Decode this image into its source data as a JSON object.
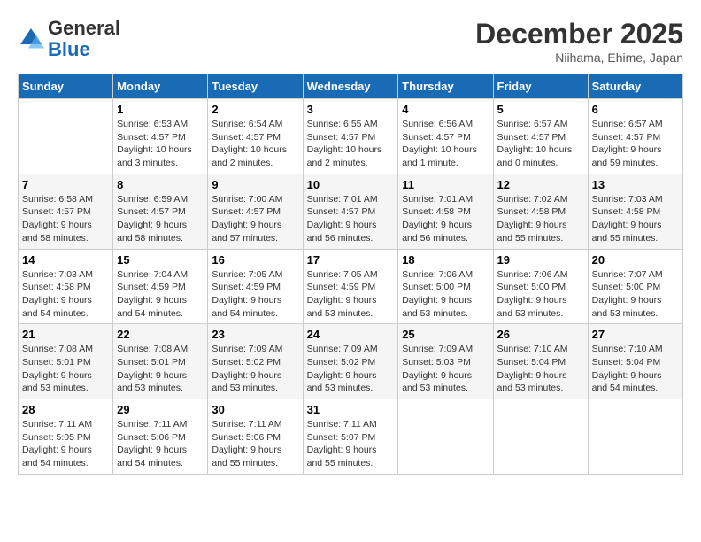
{
  "header": {
    "logo_line1": "General",
    "logo_line2": "Blue",
    "month": "December 2025",
    "location": "Niihama, Ehime, Japan"
  },
  "weekdays": [
    "Sunday",
    "Monday",
    "Tuesday",
    "Wednesday",
    "Thursday",
    "Friday",
    "Saturday"
  ],
  "weeks": [
    [
      {
        "day": "",
        "sunrise": "",
        "sunset": "",
        "daylight": ""
      },
      {
        "day": "1",
        "sunrise": "Sunrise: 6:53 AM",
        "sunset": "Sunset: 4:57 PM",
        "daylight": "Daylight: 10 hours and 3 minutes."
      },
      {
        "day": "2",
        "sunrise": "Sunrise: 6:54 AM",
        "sunset": "Sunset: 4:57 PM",
        "daylight": "Daylight: 10 hours and 2 minutes."
      },
      {
        "day": "3",
        "sunrise": "Sunrise: 6:55 AM",
        "sunset": "Sunset: 4:57 PM",
        "daylight": "Daylight: 10 hours and 2 minutes."
      },
      {
        "day": "4",
        "sunrise": "Sunrise: 6:56 AM",
        "sunset": "Sunset: 4:57 PM",
        "daylight": "Daylight: 10 hours and 1 minute."
      },
      {
        "day": "5",
        "sunrise": "Sunrise: 6:57 AM",
        "sunset": "Sunset: 4:57 PM",
        "daylight": "Daylight: 10 hours and 0 minutes."
      },
      {
        "day": "6",
        "sunrise": "Sunrise: 6:57 AM",
        "sunset": "Sunset: 4:57 PM",
        "daylight": "Daylight: 9 hours and 59 minutes."
      }
    ],
    [
      {
        "day": "7",
        "sunrise": "Sunrise: 6:58 AM",
        "sunset": "Sunset: 4:57 PM",
        "daylight": "Daylight: 9 hours and 58 minutes."
      },
      {
        "day": "8",
        "sunrise": "Sunrise: 6:59 AM",
        "sunset": "Sunset: 4:57 PM",
        "daylight": "Daylight: 9 hours and 58 minutes."
      },
      {
        "day": "9",
        "sunrise": "Sunrise: 7:00 AM",
        "sunset": "Sunset: 4:57 PM",
        "daylight": "Daylight: 9 hours and 57 minutes."
      },
      {
        "day": "10",
        "sunrise": "Sunrise: 7:01 AM",
        "sunset": "Sunset: 4:57 PM",
        "daylight": "Daylight: 9 hours and 56 minutes."
      },
      {
        "day": "11",
        "sunrise": "Sunrise: 7:01 AM",
        "sunset": "Sunset: 4:58 PM",
        "daylight": "Daylight: 9 hours and 56 minutes."
      },
      {
        "day": "12",
        "sunrise": "Sunrise: 7:02 AM",
        "sunset": "Sunset: 4:58 PM",
        "daylight": "Daylight: 9 hours and 55 minutes."
      },
      {
        "day": "13",
        "sunrise": "Sunrise: 7:03 AM",
        "sunset": "Sunset: 4:58 PM",
        "daylight": "Daylight: 9 hours and 55 minutes."
      }
    ],
    [
      {
        "day": "14",
        "sunrise": "Sunrise: 7:03 AM",
        "sunset": "Sunset: 4:58 PM",
        "daylight": "Daylight: 9 hours and 54 minutes."
      },
      {
        "day": "15",
        "sunrise": "Sunrise: 7:04 AM",
        "sunset": "Sunset: 4:59 PM",
        "daylight": "Daylight: 9 hours and 54 minutes."
      },
      {
        "day": "16",
        "sunrise": "Sunrise: 7:05 AM",
        "sunset": "Sunset: 4:59 PM",
        "daylight": "Daylight: 9 hours and 54 minutes."
      },
      {
        "day": "17",
        "sunrise": "Sunrise: 7:05 AM",
        "sunset": "Sunset: 4:59 PM",
        "daylight": "Daylight: 9 hours and 53 minutes."
      },
      {
        "day": "18",
        "sunrise": "Sunrise: 7:06 AM",
        "sunset": "Sunset: 5:00 PM",
        "daylight": "Daylight: 9 hours and 53 minutes."
      },
      {
        "day": "19",
        "sunrise": "Sunrise: 7:06 AM",
        "sunset": "Sunset: 5:00 PM",
        "daylight": "Daylight: 9 hours and 53 minutes."
      },
      {
        "day": "20",
        "sunrise": "Sunrise: 7:07 AM",
        "sunset": "Sunset: 5:00 PM",
        "daylight": "Daylight: 9 hours and 53 minutes."
      }
    ],
    [
      {
        "day": "21",
        "sunrise": "Sunrise: 7:08 AM",
        "sunset": "Sunset: 5:01 PM",
        "daylight": "Daylight: 9 hours and 53 minutes."
      },
      {
        "day": "22",
        "sunrise": "Sunrise: 7:08 AM",
        "sunset": "Sunset: 5:01 PM",
        "daylight": "Daylight: 9 hours and 53 minutes."
      },
      {
        "day": "23",
        "sunrise": "Sunrise: 7:09 AM",
        "sunset": "Sunset: 5:02 PM",
        "daylight": "Daylight: 9 hours and 53 minutes."
      },
      {
        "day": "24",
        "sunrise": "Sunrise: 7:09 AM",
        "sunset": "Sunset: 5:02 PM",
        "daylight": "Daylight: 9 hours and 53 minutes."
      },
      {
        "day": "25",
        "sunrise": "Sunrise: 7:09 AM",
        "sunset": "Sunset: 5:03 PM",
        "daylight": "Daylight: 9 hours and 53 minutes."
      },
      {
        "day": "26",
        "sunrise": "Sunrise: 7:10 AM",
        "sunset": "Sunset: 5:04 PM",
        "daylight": "Daylight: 9 hours and 53 minutes."
      },
      {
        "day": "27",
        "sunrise": "Sunrise: 7:10 AM",
        "sunset": "Sunset: 5:04 PM",
        "daylight": "Daylight: 9 hours and 54 minutes."
      }
    ],
    [
      {
        "day": "28",
        "sunrise": "Sunrise: 7:11 AM",
        "sunset": "Sunset: 5:05 PM",
        "daylight": "Daylight: 9 hours and 54 minutes."
      },
      {
        "day": "29",
        "sunrise": "Sunrise: 7:11 AM",
        "sunset": "Sunset: 5:06 PM",
        "daylight": "Daylight: 9 hours and 54 minutes."
      },
      {
        "day": "30",
        "sunrise": "Sunrise: 7:11 AM",
        "sunset": "Sunset: 5:06 PM",
        "daylight": "Daylight: 9 hours and 55 minutes."
      },
      {
        "day": "31",
        "sunrise": "Sunrise: 7:11 AM",
        "sunset": "Sunset: 5:07 PM",
        "daylight": "Daylight: 9 hours and 55 minutes."
      },
      {
        "day": "",
        "sunrise": "",
        "sunset": "",
        "daylight": ""
      },
      {
        "day": "",
        "sunrise": "",
        "sunset": "",
        "daylight": ""
      },
      {
        "day": "",
        "sunrise": "",
        "sunset": "",
        "daylight": ""
      }
    ]
  ]
}
